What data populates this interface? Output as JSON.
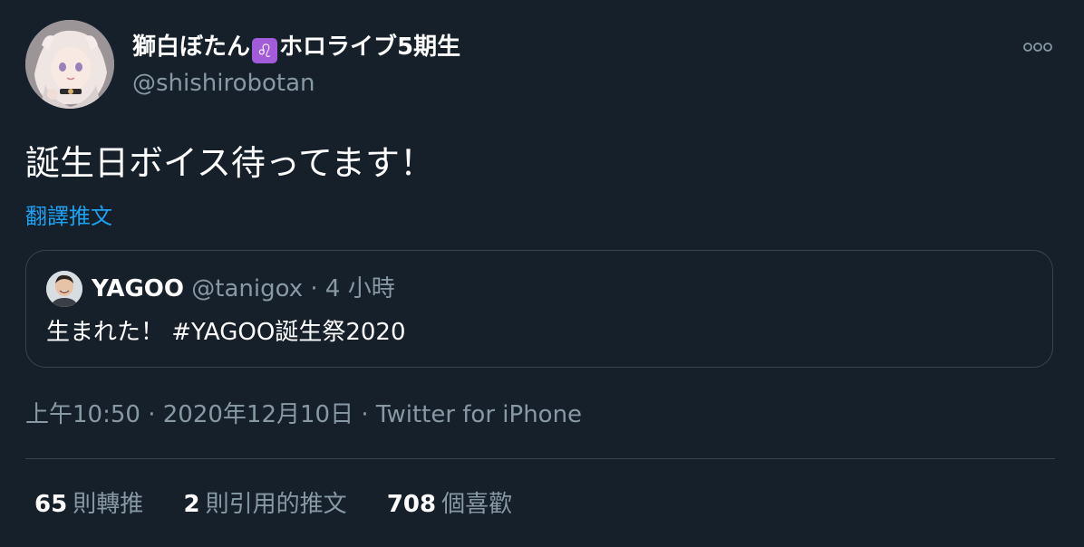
{
  "author": {
    "display_name": "獅白ぼたん",
    "zodiac_emoji": "♌",
    "display_name_suffix": "ホロライブ5期生",
    "handle": "@shishirobotan"
  },
  "more_icon": "ellipsis-icon",
  "tweet": {
    "text": "誕生日ボイス待ってます！",
    "translate_label": "翻譯推文"
  },
  "quoted_tweet": {
    "name": "YAGOO",
    "handle": "@tanigox",
    "separator": " · ",
    "time": "4 小時",
    "text": "生まれた！ #YAGOO誕生祭2020"
  },
  "meta": {
    "time": "上午10:50",
    "separator1": " · ",
    "date": "2020年12月10日",
    "separator2": " · ",
    "source": "Twitter for iPhone"
  },
  "stats": {
    "retweets_count": "65",
    "retweets_label": "則轉推",
    "quotes_count": "2",
    "quotes_label": "則引用的推文",
    "likes_count": "708",
    "likes_label": "個喜歡"
  },
  "colors": {
    "background": "#15202b",
    "text": "#ffffff",
    "secondary": "#8899a6",
    "link": "#1da1f2",
    "border": "#38444d",
    "zodiac_badge": "#a25bd9"
  }
}
